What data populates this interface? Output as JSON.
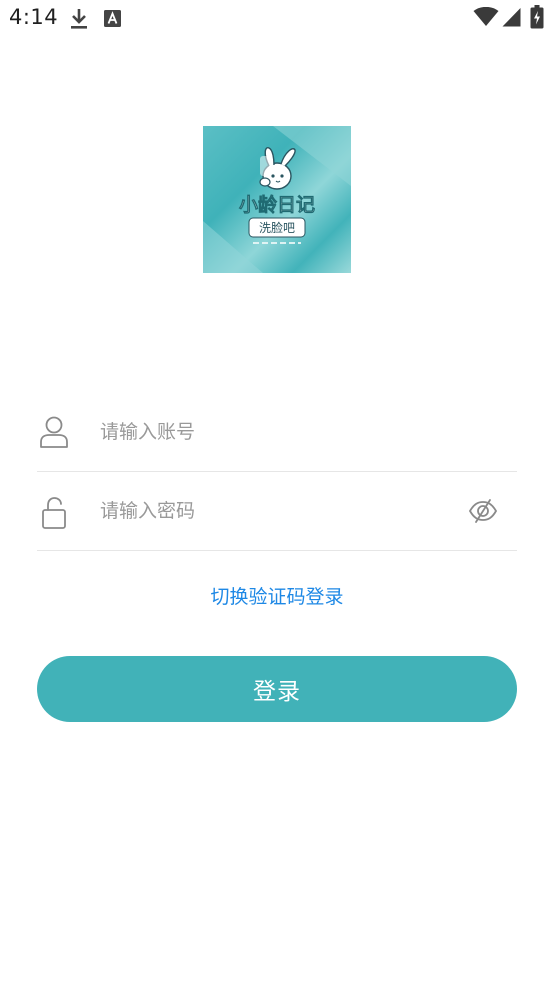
{
  "status_bar": {
    "time": "4:14",
    "icons": [
      "download-icon",
      "a-notification-icon",
      "wifi-icon",
      "signal-icon",
      "battery-icon"
    ]
  },
  "logo": {
    "name": "小龄日记",
    "subtitle": "洗脸吧",
    "colors": {
      "base": "#41b2b8",
      "light": "#9ad9da"
    }
  },
  "login_form": {
    "account": {
      "placeholder": "请输入账号",
      "value": "",
      "icon": "user-icon"
    },
    "password": {
      "placeholder": "请输入密码",
      "value": "",
      "icon": "lock-icon",
      "toggle_icon": "eye-off-icon"
    },
    "switch_link": "切换验证码登录",
    "login_button": "登录"
  },
  "colors": {
    "accent": "#41b2b8",
    "link": "#1e88e5",
    "placeholder": "#999999",
    "divider": "#e6e6e6"
  }
}
